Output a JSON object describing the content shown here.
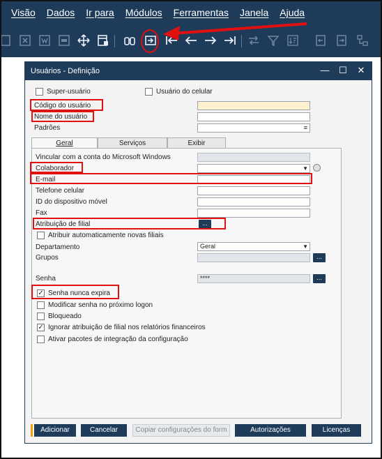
{
  "menu": [
    "Visão",
    "Dados",
    "Ir para",
    "Módulos",
    "Ferramentas",
    "Janela",
    "Ajuda"
  ],
  "toolbar_icons": [
    "document-icon",
    "excel-icon",
    "word-icon",
    "pdf-icon",
    "move-icon",
    "form-settings-icon",
    "find-icon",
    "add-icon",
    "first-record-icon",
    "previous-record-icon",
    "next-record-icon",
    "last-record-icon",
    "link-icon",
    "link-map-icon",
    "filter-icon",
    "sort-icon",
    "base-document-icon",
    "target-document-icon"
  ],
  "dialog": {
    "title": "Usuários - Definição",
    "minimize": "—",
    "maximize": "☐",
    "close": "✕",
    "super_user_label": "Super-usuário",
    "mobile_user_label": "Usuário do celular",
    "user_code_label": "Código do usuário",
    "user_name_label": "Nome do usuário",
    "defaults_label": "Padrões",
    "defaults_glyph": "≡",
    "tabs": [
      "Geral",
      "Serviços",
      "Exibir"
    ],
    "windows_account_label": "Vincular com a conta do Microsoft Windows",
    "employee_label": "Colaborador",
    "email_label": "E-mail",
    "mobile_phone_label": "Telefone celular",
    "mobile_device_label": "ID do dispositivo móvel",
    "fax_label": "Fax",
    "branch_assignment_label": "Atribuição de filial",
    "ellipsis": "...",
    "auto_assign_label": "Atribuir automaticamente novas filiais",
    "department_label": "Departamento",
    "department_value": "Geral",
    "groups_label": "Grupos",
    "password_label": "Senha",
    "password_value": "****",
    "never_expires_label": "Senha nunca expira",
    "change_next_logon_label": "Modificar senha no próximo logon",
    "locked_label": "Bloqueado",
    "ignore_branch_label": "Ignorar atribuição de filial nos relatórios financeiros",
    "enable_packages_label": "Ativar pacotes de integração da configuração",
    "check_mark": "✓",
    "buttons": {
      "add": "Adicionar",
      "cancel": "Cancelar",
      "copy_settings": "Copiar configurações do form",
      "authorizations": "Autorizações",
      "licenses": "Licenças"
    }
  },
  "colors": {
    "header": "#1e3c5a",
    "annotation": "#e01010",
    "user_code_bg": "#fdf1cf"
  }
}
